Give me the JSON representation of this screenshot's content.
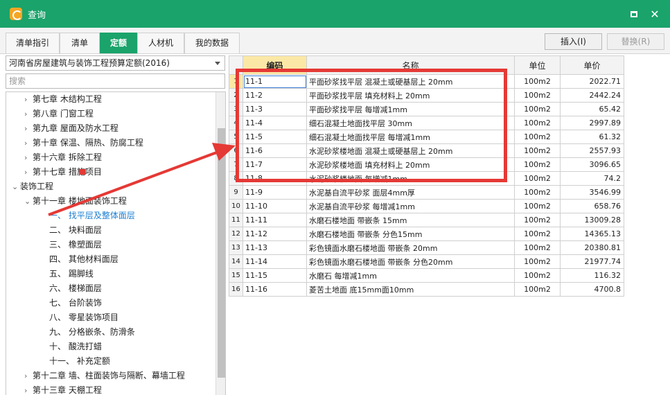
{
  "window": {
    "title": "查询"
  },
  "tabs": [
    {
      "label": "清单指引"
    },
    {
      "label": "清单"
    },
    {
      "label": "定额"
    },
    {
      "label": "人材机"
    },
    {
      "label": "我的数据"
    }
  ],
  "toolbar": {
    "insert_label": "插入(I)",
    "replace_label": "替换(R)"
  },
  "left": {
    "dropdown_value": "河南省房屋建筑与装饰工程预算定额(2016)",
    "search_placeholder": "搜索",
    "tree": [
      {
        "arrow": "›",
        "label": "第七章  木结构工程"
      },
      {
        "arrow": "›",
        "label": "第八章  门窗工程"
      },
      {
        "arrow": "›",
        "label": "第九章  屋面及防水工程"
      },
      {
        "arrow": "›",
        "label": "第十章  保温、隔热、防腐工程"
      },
      {
        "arrow": "›",
        "label": "第十六章  拆除工程"
      },
      {
        "arrow": "›",
        "label": "第十七章  措施项目"
      },
      {
        "arrow": "⌄",
        "label": "装饰工程"
      },
      {
        "arrow": "⌄",
        "label": "第十一章  楼地面装饰工程"
      },
      {
        "arrow": "",
        "label": "一、  找平层及整体面层"
      },
      {
        "arrow": "",
        "label": "二、  块料面层"
      },
      {
        "arrow": "",
        "label": "三、  橡塑面层"
      },
      {
        "arrow": "",
        "label": "四、  其他材料面层"
      },
      {
        "arrow": "",
        "label": "五、  踢脚线"
      },
      {
        "arrow": "",
        "label": "六、  楼梯面层"
      },
      {
        "arrow": "",
        "label": "七、  台阶装饰"
      },
      {
        "arrow": "",
        "label": "八、  零星装饰项目"
      },
      {
        "arrow": "",
        "label": "九、  分格嵌条、防滑条"
      },
      {
        "arrow": "",
        "label": "十、  酸洗打蜡"
      },
      {
        "arrow": "",
        "label": "十一、  补充定额"
      },
      {
        "arrow": "›",
        "label": "第十二章  墙、柱面装饰与隔断、幕墙工程"
      },
      {
        "arrow": "›",
        "label": "第十三章  天棚工程"
      }
    ]
  },
  "grid": {
    "headers": {
      "code": "编码",
      "name": "名称",
      "unit": "单位",
      "price": "单价"
    },
    "rows": [
      {
        "no": "1",
        "code": "11-1",
        "name": "平面砂浆找平层 混凝土或硬基层上 20mm",
        "unit": "100m2",
        "price": "2022.71"
      },
      {
        "no": "2",
        "code": "11-2",
        "name": "平面砂浆找平层 填充材料上 20mm",
        "unit": "100m2",
        "price": "2442.24"
      },
      {
        "no": "3",
        "code": "11-3",
        "name": "平面砂浆找平层 每增减1mm",
        "unit": "100m2",
        "price": "65.42"
      },
      {
        "no": "4",
        "code": "11-4",
        "name": "细石混凝土地面找平层 30mm",
        "unit": "100m2",
        "price": "2997.89"
      },
      {
        "no": "5",
        "code": "11-5",
        "name": "细石混凝土地面找平层 每增减1mm",
        "unit": "100m2",
        "price": "61.32"
      },
      {
        "no": "6",
        "code": "11-6",
        "name": "水泥砂浆楼地面 混凝土或硬基层上 20mm",
        "unit": "100m2",
        "price": "2557.93"
      },
      {
        "no": "7",
        "code": "11-7",
        "name": "水泥砂浆楼地面 填充材料上 20mm",
        "unit": "100m2",
        "price": "3096.65"
      },
      {
        "no": "8",
        "code": "11-8",
        "name": "水泥砂浆楼地面 每增减1mm",
        "unit": "100m2",
        "price": "74.2"
      },
      {
        "no": "9",
        "code": "11-9",
        "name": "水泥基自流平砂浆 面层4mm厚",
        "unit": "100m2",
        "price": "3546.99"
      },
      {
        "no": "10",
        "code": "11-10",
        "name": "水泥基自流平砂浆 每增减1mm",
        "unit": "100m2",
        "price": "658.76"
      },
      {
        "no": "11",
        "code": "11-11",
        "name": "水磨石楼地面 带嵌条 15mm",
        "unit": "100m2",
        "price": "13009.28"
      },
      {
        "no": "12",
        "code": "11-12",
        "name": "水磨石楼地面 带嵌条 分色15mm",
        "unit": "100m2",
        "price": "14365.13"
      },
      {
        "no": "13",
        "code": "11-13",
        "name": "彩色镜面水磨石楼地面 带嵌条 20mm",
        "unit": "100m2",
        "price": "20380.81"
      },
      {
        "no": "14",
        "code": "11-14",
        "name": "彩色镜面水磨石楼地面 带嵌条 分色20mm",
        "unit": "100m2",
        "price": "21977.74"
      },
      {
        "no": "15",
        "code": "11-15",
        "name": "水磨石 每增减1mm",
        "unit": "100m2",
        "price": "116.32"
      },
      {
        "no": "16",
        "code": "11-16",
        "name": "菱苦土地面 底15mm面10mm",
        "unit": "100m2",
        "price": "4700.8"
      }
    ]
  },
  "colors": {
    "brand": "#1aa36b",
    "annotation": "#e53935",
    "header_highlight": "#fbe8a6",
    "selected_text": "#1e7fd2"
  }
}
